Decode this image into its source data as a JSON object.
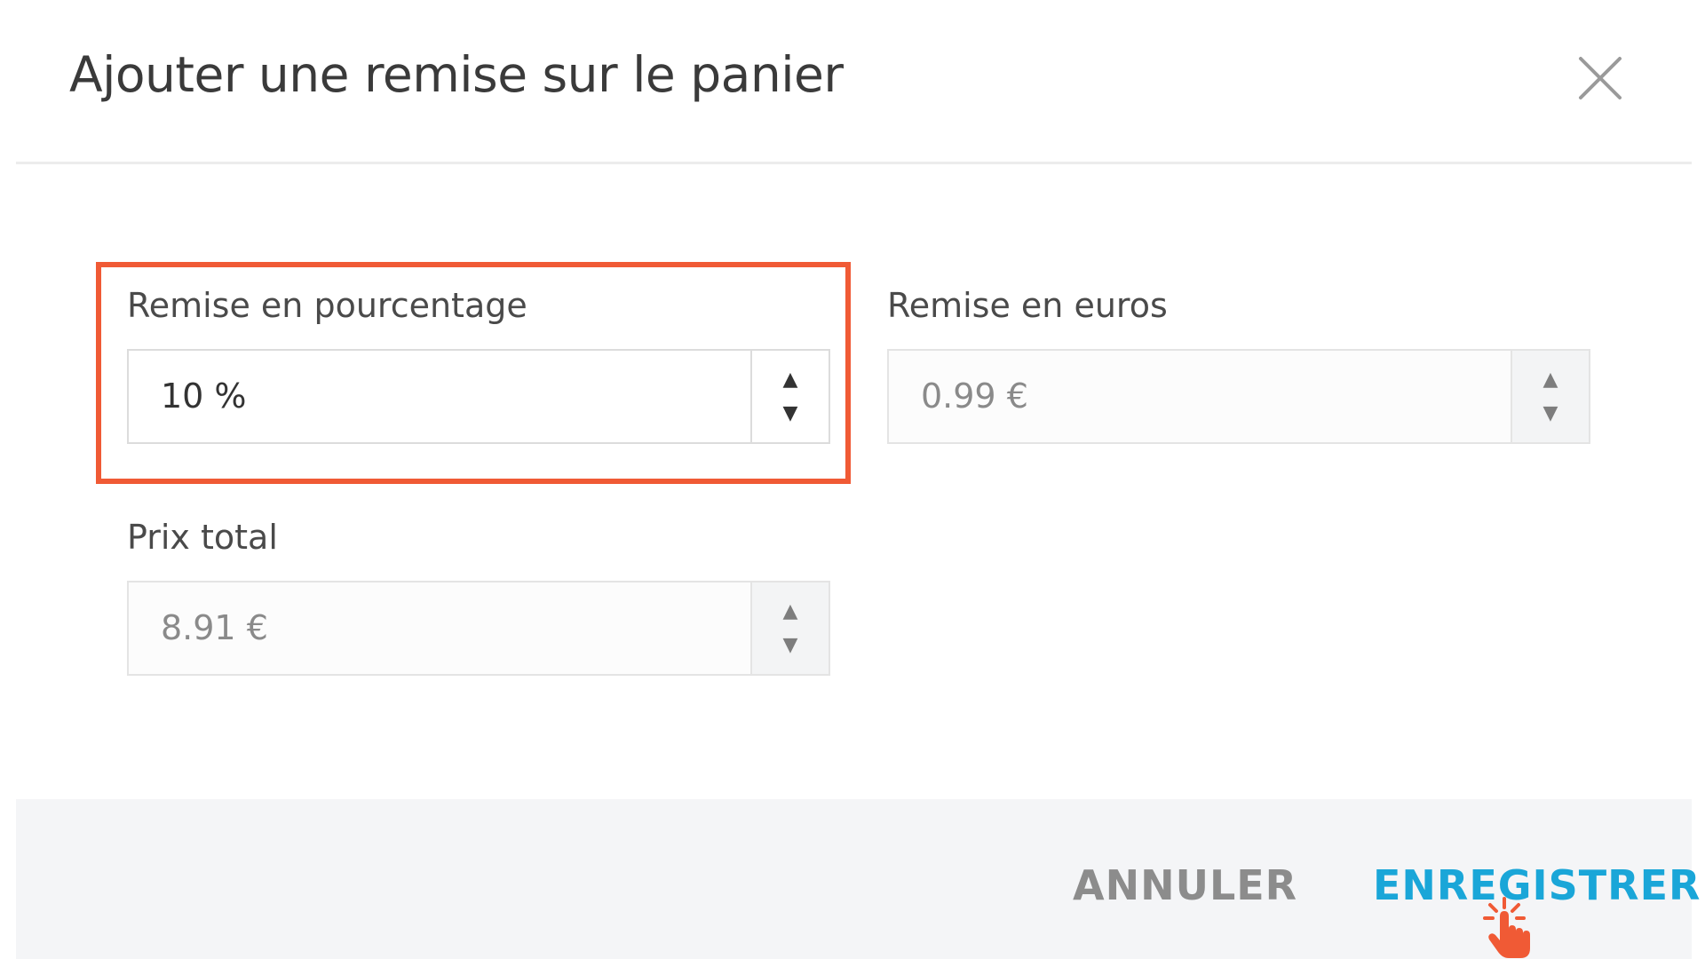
{
  "dialog": {
    "title": "Ajouter une remise sur le panier",
    "close_icon": "close-icon"
  },
  "fields": {
    "percent": {
      "label": "Remise en pourcentage",
      "value": "10 %",
      "highlighted": true
    },
    "euros": {
      "label": "Remise en euros",
      "value": "0.99 €"
    },
    "total": {
      "label": "Prix total",
      "value": "8.91 €"
    }
  },
  "spinner_icons": {
    "up": "▲",
    "down": "▼"
  },
  "footer": {
    "cancel_label": "ANNULER",
    "save_label": "ENREGISTRER"
  },
  "colors": {
    "highlight": "#f05a35",
    "save": "#1aa6d8",
    "cancel": "#8c8c8c",
    "footer_bg": "#f4f5f7",
    "cursor": "#f05a35"
  }
}
